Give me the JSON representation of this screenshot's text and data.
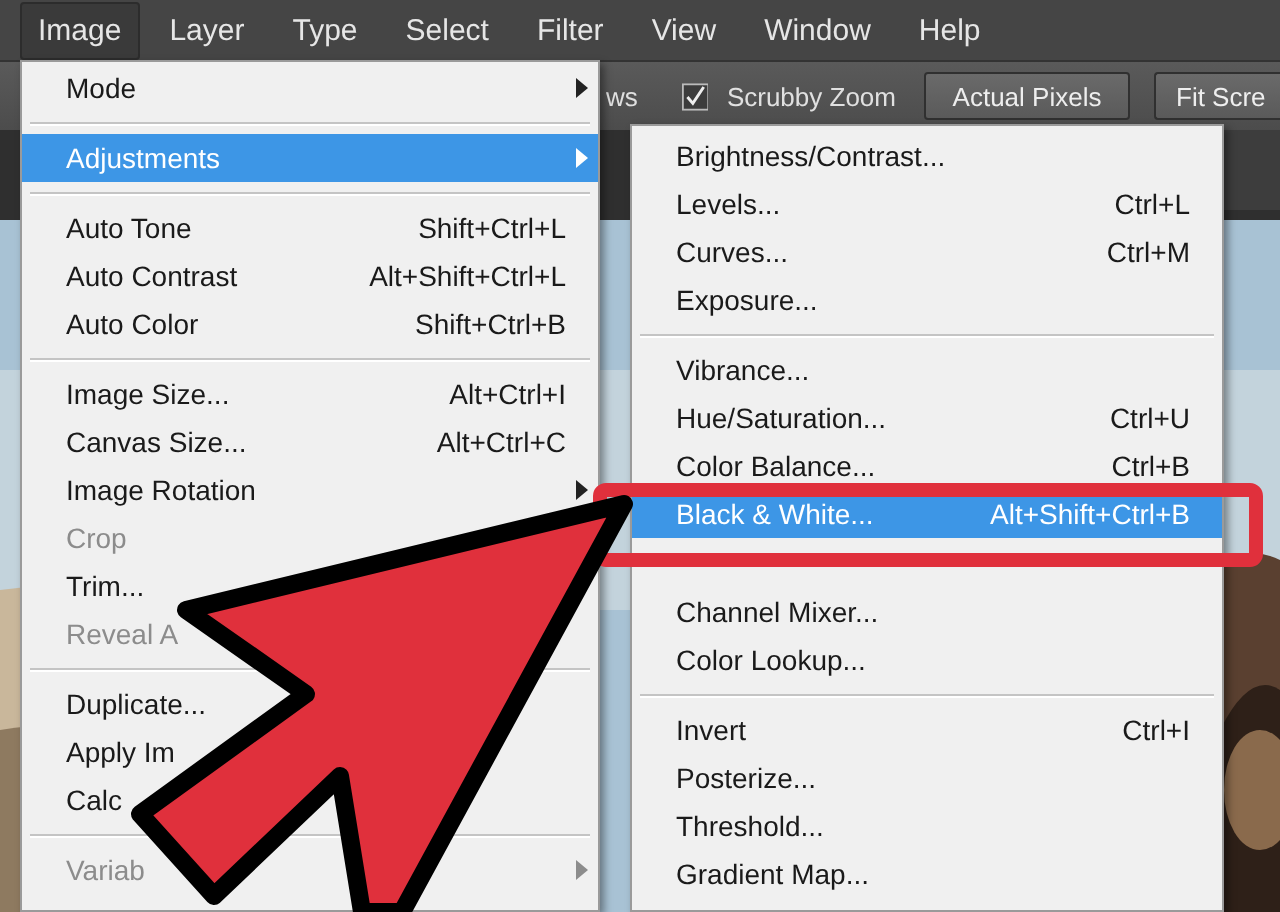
{
  "menu_bar": {
    "items": [
      {
        "label": "Image",
        "selected": true
      },
      {
        "label": "Layer",
        "selected": false
      },
      {
        "label": "Type",
        "selected": false
      },
      {
        "label": "Select",
        "selected": false
      },
      {
        "label": "Filter",
        "selected": false
      },
      {
        "label": "View",
        "selected": false
      },
      {
        "label": "Window",
        "selected": false
      },
      {
        "label": "Help",
        "selected": false
      }
    ]
  },
  "options_bar": {
    "partial_label": "ws",
    "scrubby_zoom": {
      "label": "Scrubby Zoom",
      "checked": true
    },
    "buttons": [
      "Actual Pixels",
      "Fit Scre"
    ]
  },
  "image_menu": {
    "items": [
      {
        "kind": "item",
        "label": "Mode",
        "submenu": true,
        "selected": false,
        "disabled": false
      },
      {
        "kind": "separator"
      },
      {
        "kind": "item",
        "label": "Adjustments",
        "submenu": true,
        "selected": true,
        "disabled": false
      },
      {
        "kind": "separator"
      },
      {
        "kind": "item",
        "label": "Auto Tone",
        "shortcut": "Shift+Ctrl+L",
        "selected": false,
        "disabled": false
      },
      {
        "kind": "item",
        "label": "Auto Contrast",
        "shortcut": "Alt+Shift+Ctrl+L",
        "selected": false,
        "disabled": false
      },
      {
        "kind": "item",
        "label": "Auto Color",
        "shortcut": "Shift+Ctrl+B",
        "selected": false,
        "disabled": false
      },
      {
        "kind": "separator"
      },
      {
        "kind": "item",
        "label": "Image Size...",
        "shortcut": "Alt+Ctrl+I",
        "selected": false,
        "disabled": false
      },
      {
        "kind": "item",
        "label": "Canvas Size...",
        "shortcut": "Alt+Ctrl+C",
        "selected": false,
        "disabled": false
      },
      {
        "kind": "item",
        "label": "Image Rotation",
        "submenu": true,
        "selected": false,
        "disabled": false
      },
      {
        "kind": "item",
        "label": "Crop",
        "selected": false,
        "disabled": true
      },
      {
        "kind": "item",
        "label": "Trim...",
        "selected": false,
        "disabled": false
      },
      {
        "kind": "item",
        "label": "Reveal A",
        "selected": false,
        "disabled": true
      },
      {
        "kind": "separator"
      },
      {
        "kind": "item",
        "label": "Duplicate...",
        "selected": false,
        "disabled": false
      },
      {
        "kind": "item",
        "label": "Apply Im",
        "selected": false,
        "disabled": false
      },
      {
        "kind": "item",
        "label": "Calc",
        "selected": false,
        "disabled": false
      },
      {
        "kind": "separator"
      },
      {
        "kind": "item",
        "label": "Variab",
        "submenu": true,
        "selected": false,
        "disabled": true
      }
    ]
  },
  "adjustments_menu": {
    "items": [
      {
        "kind": "item",
        "label": "Brightness/Contrast...",
        "selected": false,
        "disabled": false
      },
      {
        "kind": "item",
        "label": "Levels...",
        "shortcut": "Ctrl+L",
        "selected": false,
        "disabled": false
      },
      {
        "kind": "item",
        "label": "Curves...",
        "shortcut": "Ctrl+M",
        "selected": false,
        "disabled": false
      },
      {
        "kind": "item",
        "label": "Exposure...",
        "selected": false,
        "disabled": false
      },
      {
        "kind": "separator"
      },
      {
        "kind": "item",
        "label": "Vibrance...",
        "selected": false,
        "disabled": false
      },
      {
        "kind": "item",
        "label": "Hue/Saturation...",
        "shortcut": "Ctrl+U",
        "selected": false,
        "disabled": false
      },
      {
        "kind": "item",
        "label": "Color Balance...",
        "shortcut": "Ctrl+B",
        "selected": false,
        "disabled": false
      },
      {
        "kind": "item",
        "label": "Black & White...",
        "shortcut": "Alt+Shift+Ctrl+B",
        "selected": true,
        "disabled": false
      },
      {
        "kind": "gap"
      },
      {
        "kind": "item",
        "label": "Channel Mixer...",
        "selected": false,
        "disabled": false
      },
      {
        "kind": "item",
        "label": "Color Lookup...",
        "selected": false,
        "disabled": false
      },
      {
        "kind": "separator"
      },
      {
        "kind": "item",
        "label": "Invert",
        "shortcut": "Ctrl+I",
        "selected": false,
        "disabled": false
      },
      {
        "kind": "item",
        "label": "Posterize...",
        "selected": false,
        "disabled": false
      },
      {
        "kind": "item",
        "label": "Threshold...",
        "selected": false,
        "disabled": false
      },
      {
        "kind": "item",
        "label": "Gradient Map...",
        "selected": false,
        "disabled": false
      }
    ]
  }
}
